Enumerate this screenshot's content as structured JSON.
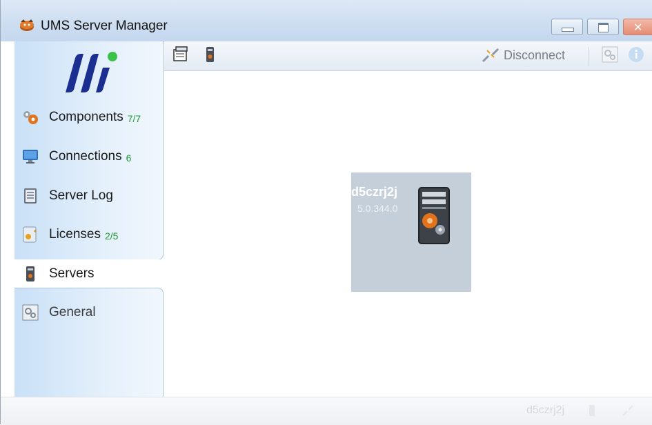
{
  "window": {
    "title": "UMS Server Manager"
  },
  "sidebar": {
    "items": [
      {
        "label": "Components",
        "count": "7/7",
        "icon": "gears-icon"
      },
      {
        "label": "Connections",
        "count": "6",
        "icon": "monitor-icon"
      },
      {
        "label": "Server Log",
        "count": "",
        "icon": "log-icon"
      },
      {
        "label": "Licenses",
        "count": "2/5",
        "icon": "key-icon"
      },
      {
        "label": "Servers",
        "count": "",
        "icon": "server-icon",
        "selected": true
      },
      {
        "label": "General",
        "count": "",
        "icon": "settings-icon"
      }
    ]
  },
  "toolbar": {
    "disconnect_label": "Disconnect"
  },
  "server": {
    "name": "d5czrj2j",
    "version": "5.0.344.0"
  },
  "statusbar": {
    "server": "d5czrj2j"
  },
  "colors": {
    "accent": "#1a2f8f",
    "count_green": "#1d9a2f",
    "tile_bg": "#c5cfd9"
  }
}
